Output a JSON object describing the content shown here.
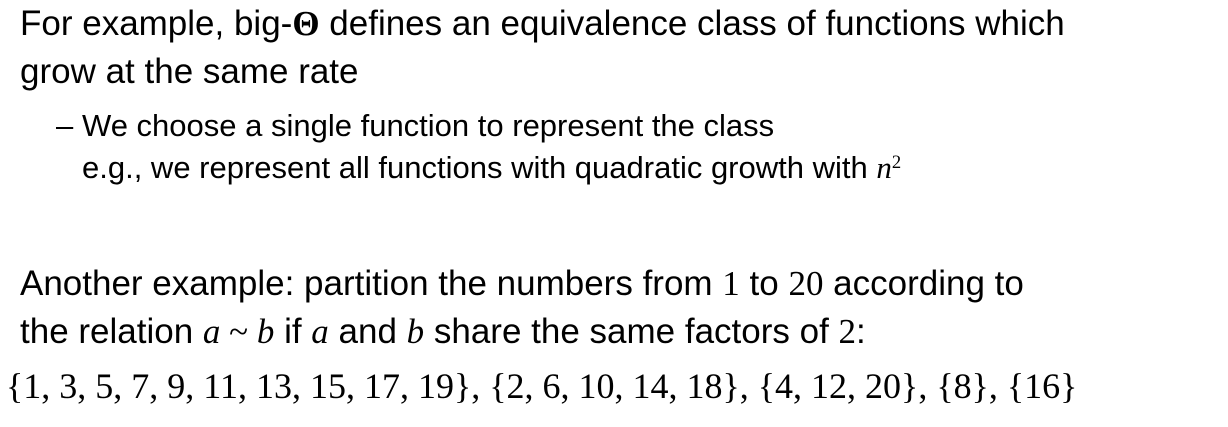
{
  "p1": {
    "line1": {
      "before": "For example, big-",
      "theta": "Θ",
      "after": " defines an equivalence class of functions which"
    },
    "line2": "grow at the same rate"
  },
  "bullet": {
    "dash": "–",
    "line1": "We choose a single function to represent the class",
    "line2": {
      "before": "e.g., we represent all functions with quadratic growth with ",
      "var": "n",
      "exp": "2"
    }
  },
  "p2": {
    "line1": {
      "before": "Another example:  partition the numbers from ",
      "from": "1",
      "mid": " to ",
      "to": "20",
      "after": " according to"
    },
    "line2": {
      "before": "the relation ",
      "rel_a": "a",
      "sim": " ~ ",
      "rel_b": "b",
      "if": " if ",
      "a": "a",
      "and": " and ",
      "b": "b",
      "rest": " share the same factors of ",
      "two": "2",
      "colon": ":"
    },
    "sets": "{1, 3, 5, 7, 9, 11, 13, 15, 17, 19}, {2, 6, 10, 14, 18}, {4, 12, 20}, {8}, {16}"
  }
}
